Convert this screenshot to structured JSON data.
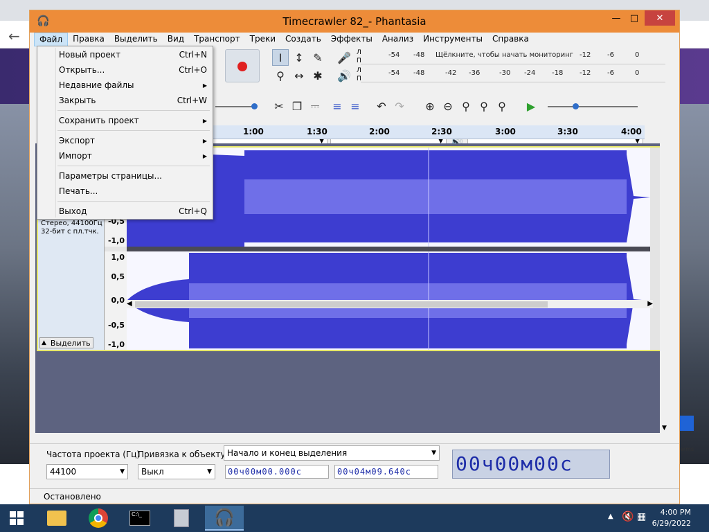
{
  "window": {
    "title": "Timecrawler 82_- Phantasia"
  },
  "menubar": [
    "Файл",
    "Правка",
    "Выделить",
    "Вид",
    "Транспорт",
    "Треки",
    "Создать",
    "Эффекты",
    "Анализ",
    "Инструменты",
    "Справка"
  ],
  "file_menu": {
    "new": "Новый проект",
    "new_sc": "Ctrl+N",
    "open": "Открыть...",
    "open_sc": "Ctrl+O",
    "recent": "Недавние файлы",
    "close": "Закрыть",
    "close_sc": "Ctrl+W",
    "save": "Сохранить проект",
    "export": "Экспорт",
    "import": "Импорт",
    "page_setup": "Параметры страницы...",
    "print": "Печать...",
    "exit": "Выход",
    "exit_sc": "Ctrl+Q"
  },
  "meters": {
    "channel_l": "Л",
    "channel_r": "П",
    "record_hint": "Щёлкните, чтобы начать мониторинг",
    "rec_ticks": [
      "-54",
      "-48",
      "-12",
      "-6",
      "0"
    ],
    "play_ticks": [
      "-54",
      "-48",
      "-42",
      "-36",
      "-30",
      "-24",
      "-18",
      "-12",
      "-6",
      "0"
    ]
  },
  "timeline": {
    "ticks": [
      "1:00",
      "1:30",
      "2:00",
      "2:30",
      "3:00",
      "3:30",
      "4:00"
    ]
  },
  "track": {
    "info_line1": "Стерео, 44100Гц",
    "info_line2": "32-бит с пл.тчк.",
    "select_button": "Выделить",
    "ruler_top": [
      "-0,5",
      "-1,0"
    ],
    "ruler_bottom": [
      "1,0",
      "0,5",
      "0,0",
      "-0,5",
      "-1,0"
    ]
  },
  "selection_toolbar": {
    "rate_label": "Частота проекта (Гц)",
    "rate_value": "44100",
    "snap_label": "Привязка к объекту",
    "snap_value": "Выкл",
    "mode_value": "Начало и конец выделения",
    "start_time": "00ч00м00.000с",
    "end_time": "00ч04м09.640с",
    "audio_position": "00ч00м00с"
  },
  "status": {
    "text": "Остановлено"
  },
  "taskbar": {
    "time": "4:00 PM",
    "date": "6/29/2022"
  },
  "colors": {
    "titlebar": "#ed8c39",
    "waveform": "#3d3dd0",
    "waveform_rms": "#6f6fe8",
    "time_digits": "#1d2ca8"
  }
}
